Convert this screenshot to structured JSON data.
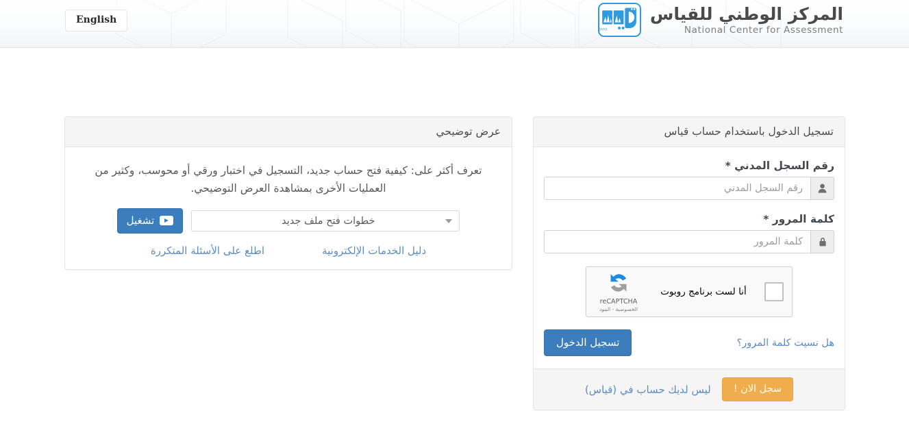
{
  "header": {
    "lang_button": "English",
    "brand_ar": "المركز الوطني للقياس",
    "brand_en": "National Center for Assessment",
    "logo_mark": "qiyas-logo",
    "logo_caption": "QIYAS"
  },
  "promo": {
    "title": "عرض توضيحي",
    "description": "تعرف أكثر على: كيفية فتح حساب جديد، التسجيل في اختبار ورقي أو محوسب، وكثير من العمليات الأخرى بمشاهدة العرض التوضيحي.",
    "play_button": "تشغيل",
    "video_select_value": "خطوات فتح ملف جديد",
    "link_faq": "اطلع على الأسئلة المتكررة",
    "link_eservices": "دليل الخدمات الإلكترونية"
  },
  "login": {
    "title": "تسجيل الدخول باستخدام حساب قياس",
    "civil_id_label": "رقم السجل المدني",
    "civil_id_required": "*",
    "civil_id_placeholder": "رقم السجل المدني",
    "civil_id_value": "",
    "password_label": "كلمة المرور",
    "password_required": "*",
    "password_placeholder": "كلمة المرور",
    "password_value": "",
    "forgot_password": "هل نسيت كلمة المرور؟",
    "submit_button": "تسجيل الدخول",
    "footer_text": "ليس لديك حساب في (قياس)",
    "register_button": "سجل الان !"
  },
  "recaptcha": {
    "label": "أنا لست برنامج روبوت",
    "brand": "reCAPTCHA",
    "legal": "الخصوصية - البنود",
    "checked": false
  },
  "colors": {
    "primary_blue": "#3b7dbd",
    "link_blue": "#5b8cc4",
    "accent_orange": "#f0ad4e",
    "logo_blue": "#2f9ae0",
    "panel_head_bg": "#f5f5f5",
    "border_gray": "#e4e4e4"
  }
}
